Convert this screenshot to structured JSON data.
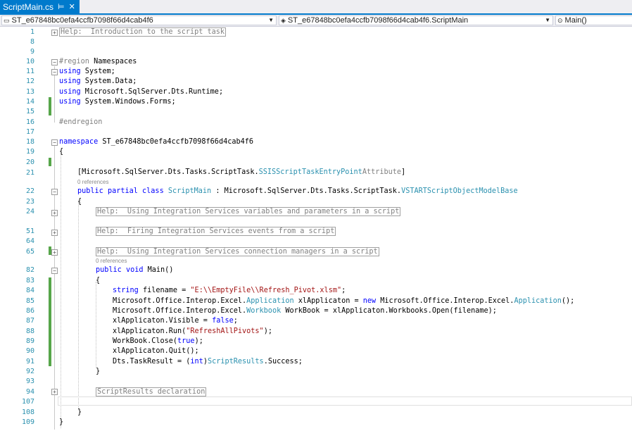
{
  "tab": {
    "title": "ScriptMain.cs",
    "pin": "⊨",
    "close": "✕"
  },
  "nav": {
    "project": "ST_e67848bc0efa4ccfb7098f66d4cab4f6",
    "class": "ST_e67848bc0efa4ccfb7098f66d4cab4f6.ScriptMain",
    "member": "Main()"
  },
  "lines": {
    "l1": "1",
    "l8": "8",
    "l9": "9",
    "l10": "10",
    "l11": "11",
    "l12": "12",
    "l13": "13",
    "l14": "14",
    "l15": "15",
    "l16": "16",
    "l17": "17",
    "l18": "18",
    "l19": "19",
    "l20": "20",
    "l21": "21",
    "l22": "22",
    "l23": "23",
    "l24": "24",
    "l51": "51",
    "l64": "64",
    "l65": "65",
    "l82": "82",
    "l83": "83",
    "l84": "84",
    "l85": "85",
    "l86": "86",
    "l87": "87",
    "l88": "88",
    "l89": "89",
    "l90": "90",
    "l91": "91",
    "l92": "92",
    "l93": "93",
    "l94": "94",
    "l107": "107",
    "l108": "108",
    "l109": "109"
  },
  "code": {
    "help_intro": "Help:  Introduction to the script task",
    "region_kw": "#region",
    "region_name": " Namespaces",
    "using_kw": "using",
    "ns_system": " System;",
    "ns_data": " System.Data;",
    "ns_runtime": " Microsoft.SqlServer.Dts.Runtime;",
    "ns_forms": " System.Windows.Forms;",
    "endregion": "#endregion",
    "namespace_kw": "namespace",
    "namespace_name": " ST_e67848bc0efa4ccfb7098f66d4cab4f6",
    "open_brace": "{",
    "close_brace": "}",
    "attr_open": "[Microsoft.SqlServer.Dts.Tasks.ScriptTask.",
    "attr_type": "SSISScriptTaskEntryPoint",
    "attr_suffix": "Attribute",
    "attr_close": "]",
    "refs": "0 references",
    "public_kw": "public",
    "partial_kw": "partial",
    "class_kw": "class",
    "class_name": "ScriptMain",
    "base_prefix": " : Microsoft.SqlServer.Dts.Tasks.ScriptTask.",
    "base_type": "VSTARTScriptObjectModelBase",
    "help_vars": "Help:  Using Integration Services variables and parameters in a script",
    "help_events": "Help:  Firing Integration Services events from a script",
    "help_conn": "Help:  Using Integration Services connection managers in a script",
    "void_kw": "void",
    "main_sig": " Main()",
    "string_kw": "string",
    "filename_decl": " filename = ",
    "filename_val": "\"E:\\\\EmptyFile\\\\Refresh_Pivot.xlsm\"",
    "semi": ";",
    "l85_a": "Microsoft.Office.Interop.Excel.",
    "l85_app": "Application",
    "l85_b": " xlApplicaton = ",
    "new_kw": "new",
    "l85_c": " Microsoft.Office.Interop.Excel.",
    "l85_end": "();",
    "l86_a": "Microsoft.Office.Interop.Excel.",
    "l86_wb": "Workbook",
    "l86_b": " WorkBook = xlApplicaton.Workbooks.Open(filename);",
    "l87_a": "xlApplicaton.Visible = ",
    "false_kw": "false",
    "l88_a": "xlApplicaton.Run(",
    "l88_str": "\"RefreshAllPivots\"",
    "l88_end": ");",
    "l89_a": "WorkBook.Close(",
    "true_kw": "true",
    "l89_end": ");",
    "l90": "xlApplicaton.Quit();",
    "l91_a": "Dts.TaskResult = (",
    "int_kw": "int",
    "l91_b": ")",
    "l91_type": "ScriptResults",
    "l91_end": ".Success;",
    "script_results": "ScriptResults declaration"
  },
  "fold_symbols": {
    "plus": "+",
    "minus": "−"
  },
  "colors": {
    "accent": "#007acc",
    "keyword": "#0000ff",
    "type": "#2b91af",
    "string": "#a31515",
    "line_number": "#2b91af",
    "change_bar": "#57a64a"
  }
}
